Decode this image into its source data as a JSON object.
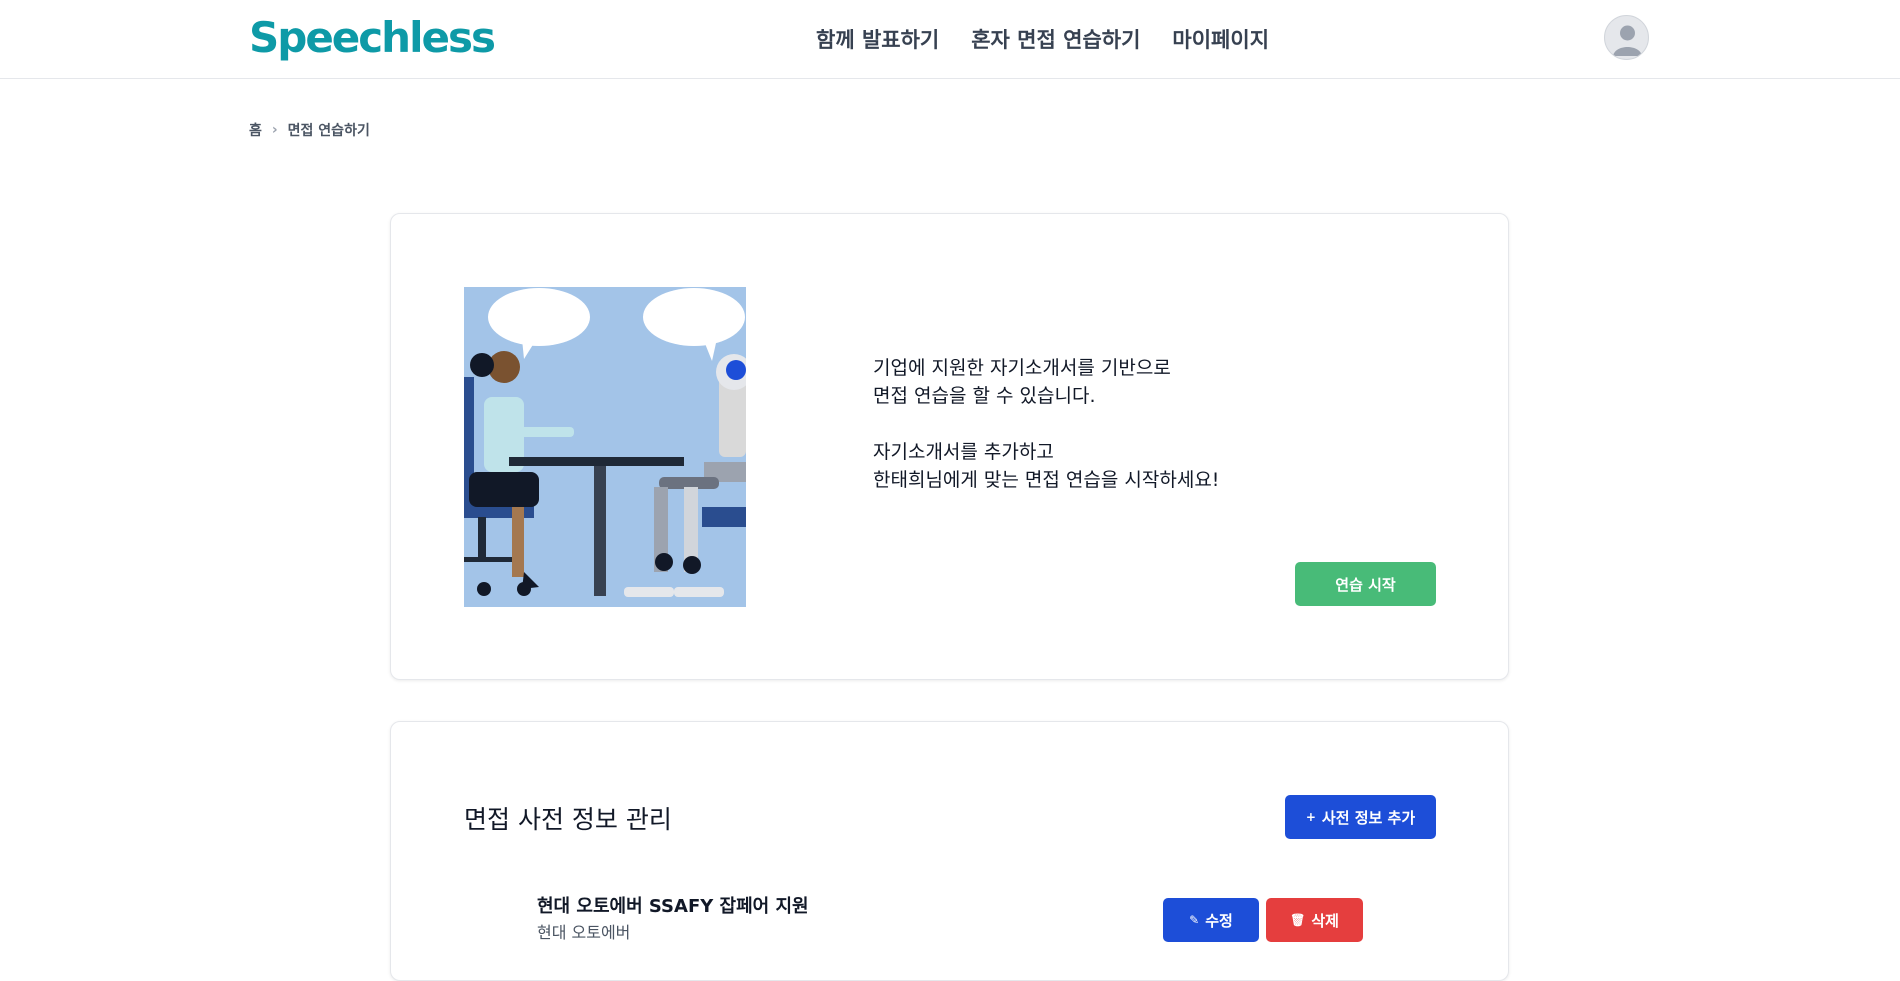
{
  "header": {
    "logo": "Speechless",
    "nav": [
      "함께 발표하기",
      "혼자 면접 연습하기",
      "마이페이지"
    ]
  },
  "breadcrumb": {
    "home": "홈",
    "current": "면접 연습하기"
  },
  "intro": {
    "line1": "기업에 지원한 자기소개서를 기반으로",
    "line2": "면접 연습을 할 수 있습니다.",
    "line3": "자기소개서를 추가하고",
    "line4": "한태희님에게 맞는 면접 연습을 시작하세요!",
    "start_button": "연습 시작"
  },
  "manage": {
    "title": "면접 사전 정보 관리",
    "add_button": "사전 정보 추가",
    "items": [
      {
        "title": "현대 오토에버 SSAFY 잡페어 지원",
        "company": "현대 오토에버",
        "edit_label": "수정",
        "delete_label": "삭제"
      }
    ]
  },
  "colors": {
    "brand": "#0e9aa7",
    "primary": "#1d4ed8",
    "success": "#48bb78",
    "danger": "#e53e3e"
  }
}
